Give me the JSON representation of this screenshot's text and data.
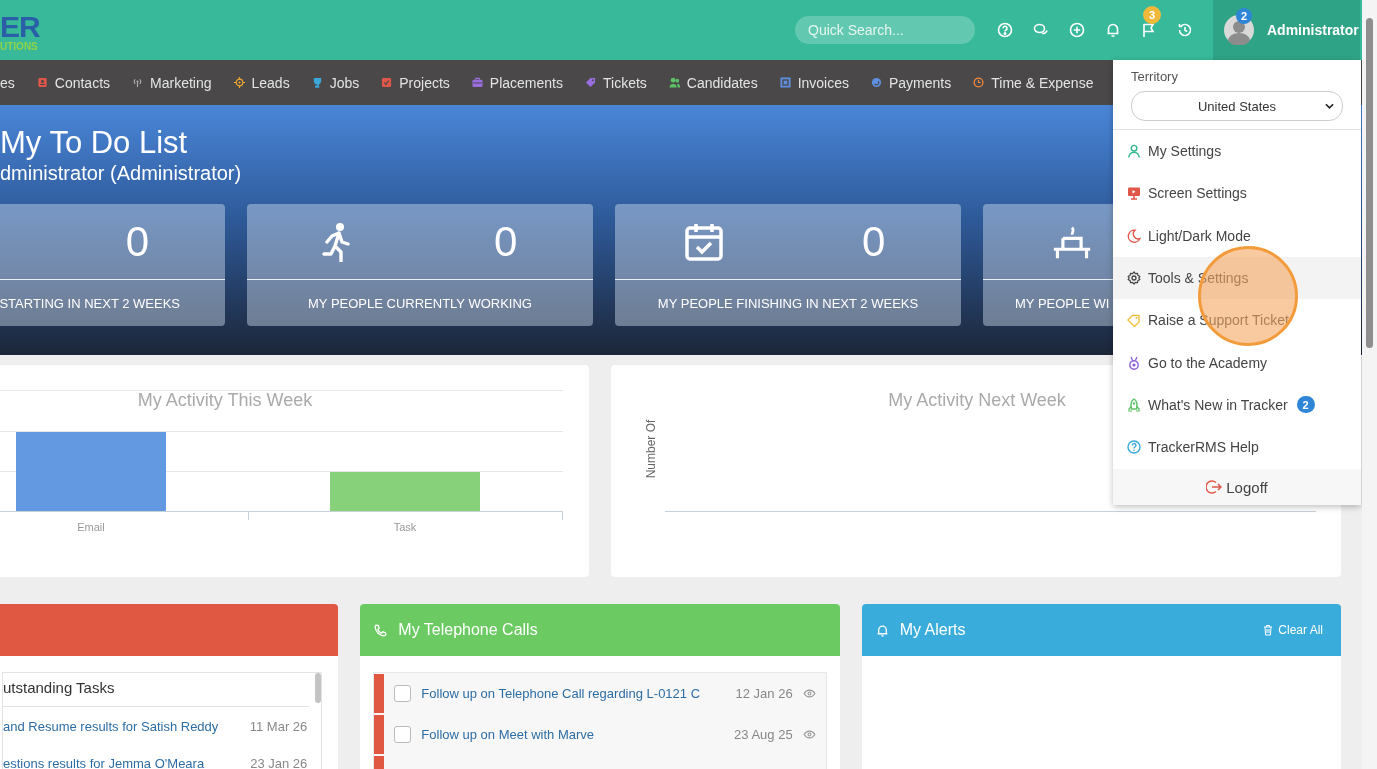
{
  "header": {
    "logo": {
      "mark": "ER",
      "tagline": "UTIONS"
    },
    "search": {
      "placeholder": "Quick Search..."
    },
    "toolbar_icons": [
      {
        "kind": "help"
      },
      {
        "kind": "chat"
      },
      {
        "kind": "add"
      },
      {
        "kind": "bell"
      },
      {
        "kind": "flag",
        "badge": "3"
      },
      {
        "kind": "history"
      }
    ],
    "user": {
      "name": "Administrator",
      "badge": "2"
    }
  },
  "nav": [
    {
      "label": "es"
    },
    {
      "label": "Contacts",
      "kind": "contact",
      "color": "#e0574a"
    },
    {
      "label": "Marketing",
      "kind": "signal",
      "color": "#b5b5b5"
    },
    {
      "label": "Leads",
      "kind": "target",
      "color": "#f0a830"
    },
    {
      "label": "Jobs",
      "kind": "trophy",
      "color": "#3aa7d8"
    },
    {
      "label": "Projects",
      "kind": "check",
      "color": "#e0574a"
    },
    {
      "label": "Placements",
      "kind": "briefcase",
      "color": "#9a6ee0"
    },
    {
      "label": "Tickets",
      "kind": "tag",
      "color": "#9a6ee0"
    },
    {
      "label": "Candidates",
      "kind": "people",
      "color": "#5cc265"
    },
    {
      "label": "Invoices",
      "kind": "square",
      "color": "#5f8fe0"
    },
    {
      "label": "Payments",
      "kind": "coins",
      "color": "#5f8fe0"
    },
    {
      "label": "Time & Expense",
      "kind": "clock",
      "color": "#f08a40"
    }
  ],
  "hero": {
    "title": "My To Do List",
    "subtitle": "dministrator (Administrator)",
    "stats": [
      {
        "value": "0",
        "label": "STARTING IN NEXT 2 WEEKS"
      },
      {
        "kind": "runner",
        "value": "0",
        "label": "MY PEOPLE CURRENTLY WORKING"
      },
      {
        "kind": "calendar",
        "value": "0",
        "label": "MY PEOPLE FINISHING IN NEXT 2 WEEKS"
      },
      {
        "kind": "desk",
        "label": "MY PEOPLE WI"
      }
    ]
  },
  "charts": [
    {
      "title": "My Activity This Week",
      "x_labels": [
        "Email",
        "Task"
      ]
    },
    {
      "title": "My Activity Next Week",
      "ylabel": "Number Of"
    }
  ],
  "tasks_panel": {
    "heading": "utstanding Tasks",
    "rows": [
      {
        "text": "and Resume results for Satish Reddy",
        "date": "11 Mar 26"
      },
      {
        "text": "estions results for Jemma O'Meara",
        "date": "23 Jan 26"
      }
    ]
  },
  "calls_panel": {
    "title": "My Telephone Calls",
    "rows": [
      {
        "text": "Follow up on Telephone Call regarding L-0121 C",
        "date": "12 Jan 26",
        "checked": false
      },
      {
        "text": "Follow up on Meet with Marve",
        "date": "23 Aug 25",
        "checked": false
      }
    ]
  },
  "alerts_panel": {
    "title": "My Alerts",
    "action": "Clear All"
  },
  "user_menu": {
    "territory_label": "Territory",
    "territory": "United States",
    "items": [
      {
        "kind": "person",
        "label": "My Settings",
        "color": "#2eb88a",
        "selected": false
      },
      {
        "kind": "screen",
        "label": "Screen Settings",
        "color": "#e0574a",
        "selected": false
      },
      {
        "kind": "moon",
        "label": "Light/Dark Mode",
        "color": "#e0574a",
        "selected": false
      },
      {
        "kind": "gear",
        "label": "Tools & Settings",
        "color": "#444444",
        "selected": true
      },
      {
        "kind": "tag",
        "label": "Raise a Support Ticket",
        "color": "#f0c040",
        "selected": false
      },
      {
        "kind": "medal",
        "label": "Go to the Academy",
        "color": "#8a5cd8",
        "selected": false
      },
      {
        "kind": "rocket",
        "label": "What's New in Tracker",
        "color": "#5cc265",
        "badge": "2",
        "selected": false
      },
      {
        "kind": "help",
        "label": "TrackerRMS Help",
        "color": "#3aa7d8",
        "selected": false
      }
    ],
    "logoff": "Logoff"
  },
  "click_highlight": true
}
